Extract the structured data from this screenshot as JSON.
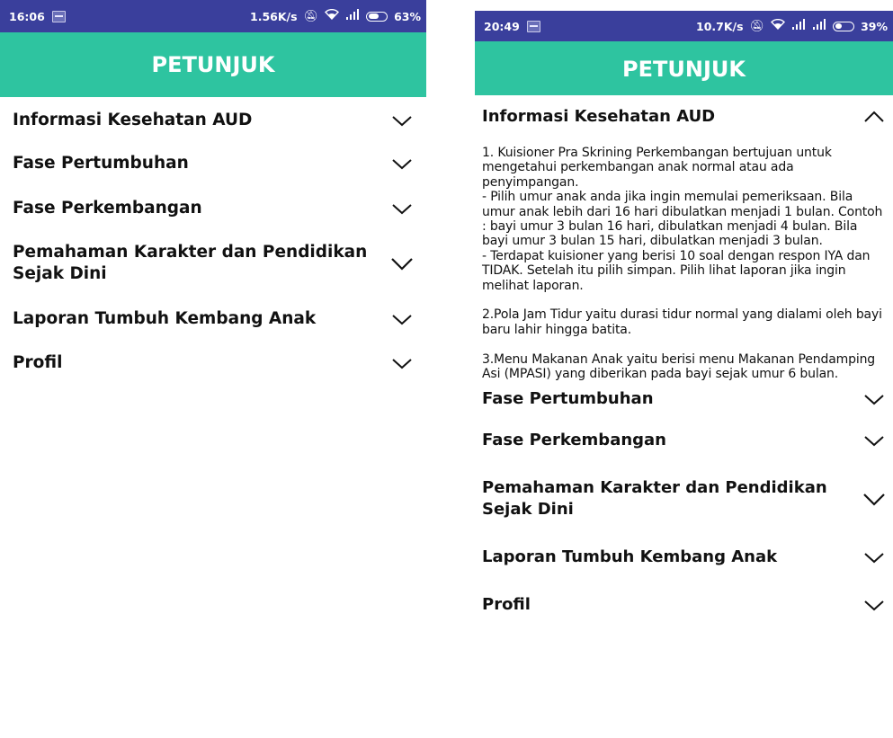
{
  "left": {
    "status": {
      "time": "16:06",
      "speed": "1.56K/s",
      "battery": "63%",
      "battery_level": 0.63
    },
    "title": "PETUNJUK",
    "items": [
      {
        "label": "Informasi Kesehatan AUD"
      },
      {
        "label": "Fase Pertumbuhan"
      },
      {
        "label": "Fase Perkembangan"
      },
      {
        "label": "Pemahaman Karakter dan Pendidikan Sejak Dini"
      },
      {
        "label": "Laporan Tumbuh Kembang Anak"
      },
      {
        "label": "Profil"
      }
    ]
  },
  "right": {
    "status": {
      "time": "20:49",
      "speed": "10.7K/s",
      "battery": "39%",
      "battery_level": 0.39
    },
    "title": "PETUNJUK",
    "expanded": {
      "label": "Informasi Kesehatan AUD",
      "text": "1. Kuisioner Pra Skrining Perkembangan bertujuan untuk mengetahui perkembangan anak normal atau ada penyimpangan.\n- Pilih umur anak anda jika ingin memulai pemeriksaan. Bila umur anak lebih dari 16 hari dibulatkan menjadi 1 bulan. Contoh : bayi umur 3 bulan 16 hari, dibulatkan menjadi 4 bulan. Bila bayi umur 3 bulan 15 hari, dibulatkan menjadi 3 bulan.\n- Terdapat kuisioner yang berisi 10 soal dengan respon IYA dan TIDAK. Setelah itu pilih simpan. Pilih lihat laporan jika ingin melihat laporan.\n\n2.Pola Jam Tidur yaitu durasi tidur normal yang dialami oleh bayi baru lahir hingga batita.\n\n3.Menu Makanan Anak yaitu berisi menu Makanan Pendamping Asi (MPASI) yang diberikan pada bayi sejak umur 6 bulan."
    },
    "items": [
      {
        "label": "Fase Pertumbuhan"
      },
      {
        "label": "Fase Perkembangan"
      },
      {
        "label": "Pemahaman Karakter dan Pendidikan Sejak Dini"
      },
      {
        "label": "Laporan Tumbuh Kembang Anak"
      },
      {
        "label": "Profil"
      }
    ]
  },
  "colors": {
    "status_bar": "#3a3f9c",
    "app_bar": "#2ec4a0"
  }
}
